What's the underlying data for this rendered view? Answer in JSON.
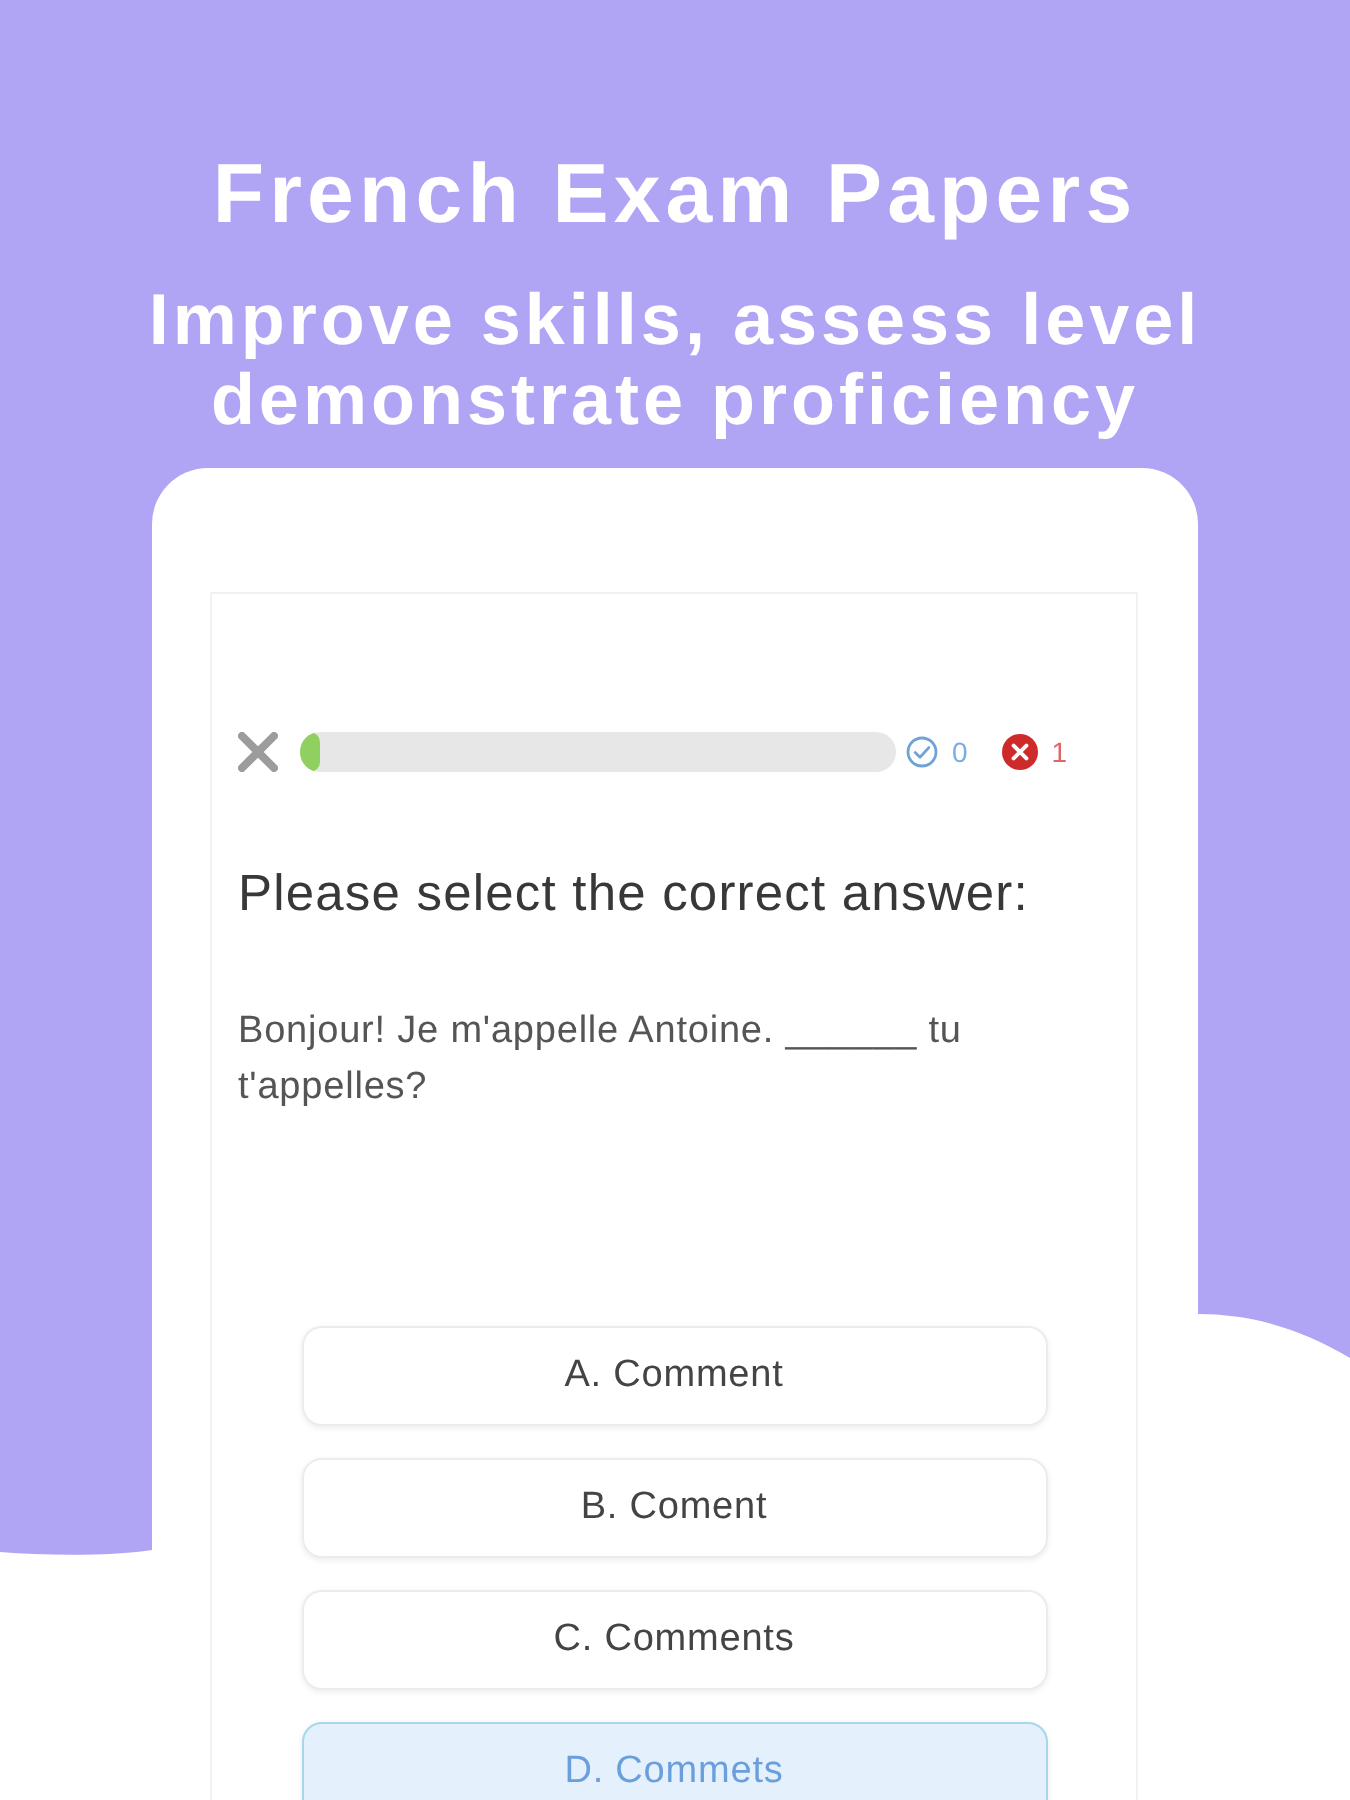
{
  "header": {
    "title": "French Exam Papers",
    "subtitle_lines": [
      "Improve skills, assess level",
      "demonstrate proficiency"
    ]
  },
  "quiz": {
    "progress": {
      "level": 0.035
    },
    "correct_count": "0",
    "wrong_count": "1",
    "prompt": "Please select the correct answer:",
    "question": "Bonjour! Je m'appelle Antoine. ______ tu t'appelles?",
    "options": [
      {
        "label": "A. Comment",
        "selected": false
      },
      {
        "label": "B. Coment",
        "selected": false
      },
      {
        "label": "C. Comments",
        "selected": false
      },
      {
        "label": "D. Commets",
        "selected": true
      }
    ]
  }
}
